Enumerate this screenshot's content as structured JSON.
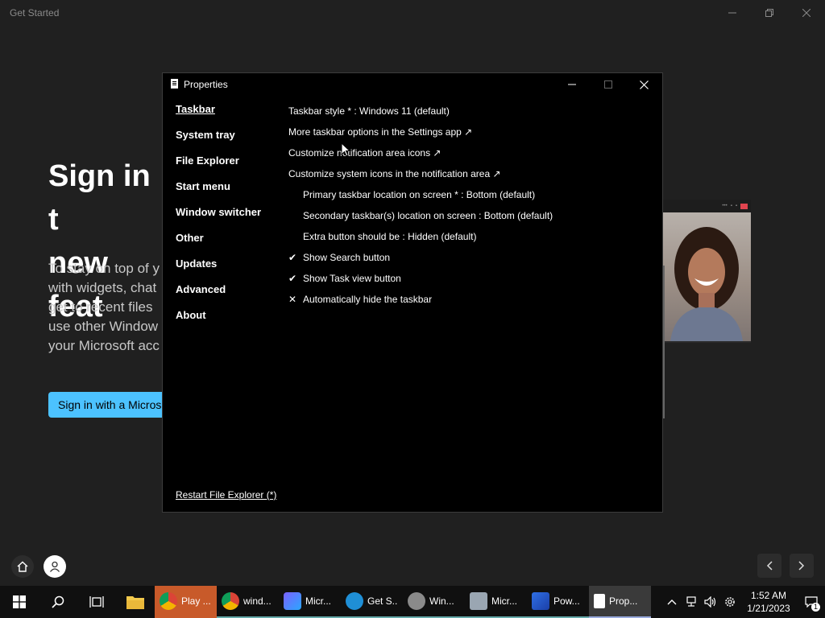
{
  "background_window": {
    "title": "Get Started",
    "hero_title": "Sign in t\nnew feat",
    "hero_body": "To stay on top of y\nwith widgets, chat\nget to recent files\nuse other Window\nyour Microsoft acc",
    "signin_button": "Sign in with a Micros"
  },
  "properties": {
    "title": "Properties",
    "nav": [
      {
        "label": "Taskbar"
      },
      {
        "label": "System tray"
      },
      {
        "label": "File Explorer"
      },
      {
        "label": "Start menu"
      },
      {
        "label": "Window switcher"
      },
      {
        "label": "Other"
      },
      {
        "label": "Updates"
      },
      {
        "label": "Advanced"
      },
      {
        "label": "About"
      }
    ],
    "options": [
      {
        "label": "Taskbar style * : Windows 11 (default)"
      },
      {
        "label": "More taskbar options in the Settings app ↗"
      },
      {
        "label": "Customize notification area icons ↗"
      },
      {
        "label": "Customize system icons in the notification area ↗"
      },
      {
        "label": "Primary taskbar location on screen * : Bottom (default)"
      },
      {
        "label": "Secondary taskbar(s) location on screen : Bottom (default)"
      },
      {
        "label": "Extra button should be : Hidden (default)"
      },
      {
        "label": "Show Search button",
        "mark": "✔"
      },
      {
        "label": "Show Task view button",
        "mark": "✔"
      },
      {
        "label": "Automatically hide the taskbar",
        "mark": "✕"
      }
    ],
    "restart_link": "Restart File Explorer (*)"
  },
  "taskbar": {
    "apps": [
      {
        "label": "Play ..."
      },
      {
        "label": "wind..."
      },
      {
        "label": "Micr..."
      },
      {
        "label": "Get S..."
      },
      {
        "label": "Win..."
      },
      {
        "label": "Micr..."
      },
      {
        "label": "Pow..."
      },
      {
        "label": "Prop..."
      }
    ],
    "time": "1:52 AM",
    "date": "1/21/2023",
    "notification_count": "1"
  },
  "colors": {
    "accent_button": "#4cc2ff",
    "highlighted_app": "#c85a2a"
  }
}
